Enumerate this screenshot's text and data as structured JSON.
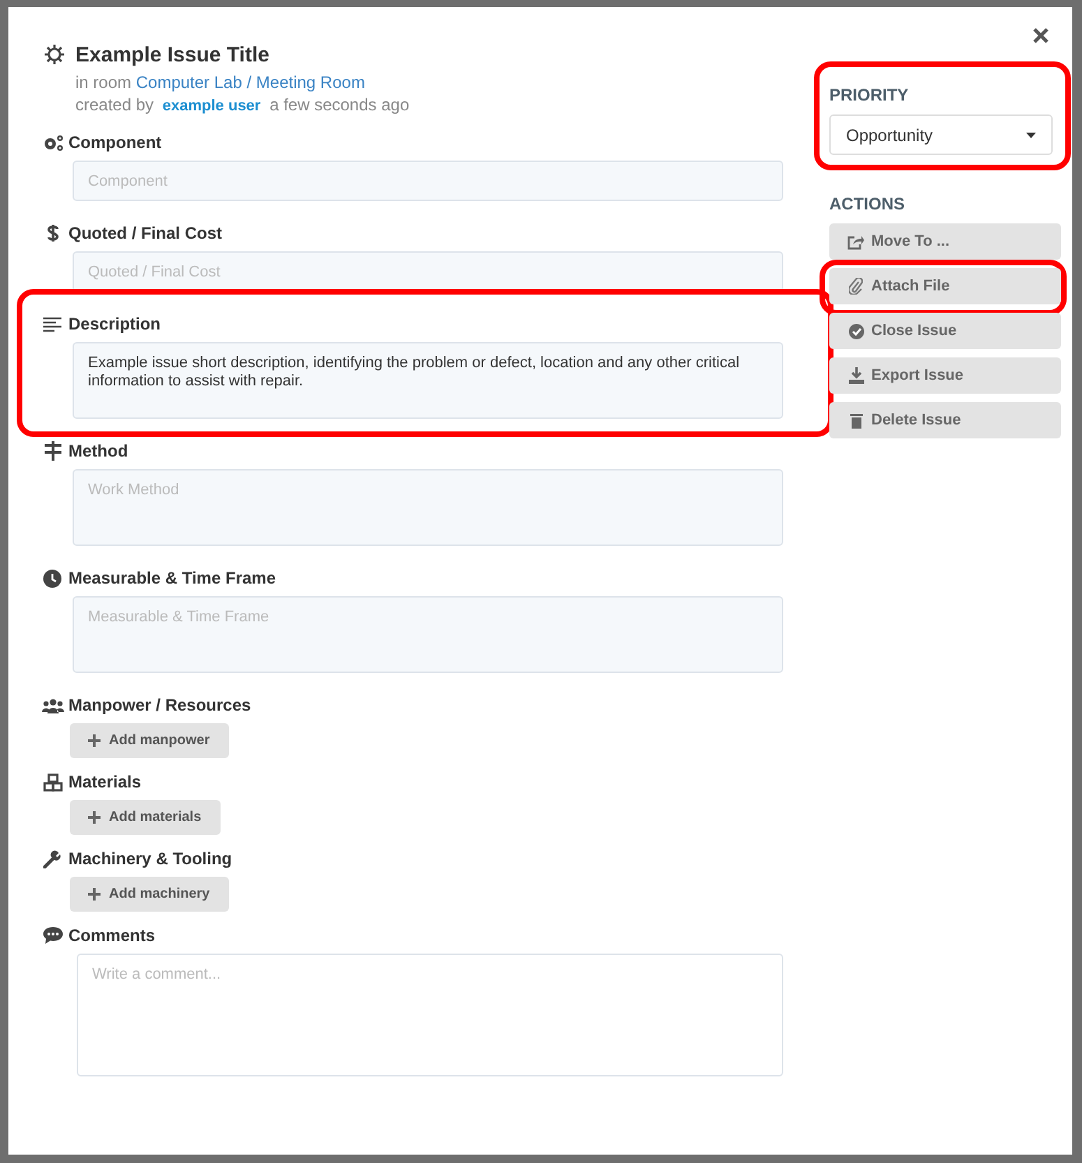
{
  "issue": {
    "title": "Example Issue Title",
    "room_prefix": "in room",
    "room": "Computer Lab / Meeting Room",
    "created_prefix": "created by",
    "user": "example user",
    "time": "a few seconds ago"
  },
  "sections": [
    {
      "label": "Component",
      "kind": "input",
      "placeholder": "Component",
      "highlighted": false
    },
    {
      "label": "Quoted / Final Cost",
      "kind": "input",
      "placeholder": "Quoted / Final Cost",
      "highlighted": false
    },
    {
      "label": "Description",
      "kind": "textarea",
      "value": "Example issue short description, identifying the problem or defect, location and any other critical information to assist with repair.",
      "highlighted": true
    },
    {
      "label": "Method",
      "kind": "textarea",
      "placeholder": "Work Method",
      "highlighted": false
    },
    {
      "label": "Measurable & Time Frame",
      "kind": "textarea",
      "placeholder": "Measurable & Time Frame",
      "highlighted": false
    },
    {
      "label": "Manpower / Resources",
      "kind": "add",
      "button": "Add manpower",
      "highlighted": false
    },
    {
      "label": "Materials",
      "kind": "add",
      "button": "Add materials",
      "highlighted": false
    },
    {
      "label": "Machinery & Tooling",
      "kind": "add",
      "button": "Add machinery",
      "highlighted": false
    },
    {
      "label": "Comments",
      "kind": "comment",
      "placeholder": "Write a comment...",
      "highlighted": false
    }
  ],
  "priority": {
    "heading": "PRIORITY",
    "value": "Opportunity",
    "highlighted": true
  },
  "actions": {
    "heading": "ACTIONS",
    "items": [
      {
        "label": "Move To ...",
        "highlighted": false
      },
      {
        "label": "Attach File",
        "highlighted": true
      },
      {
        "label": "Close Issue",
        "highlighted": false
      },
      {
        "label": "Export Issue",
        "highlighted": false
      },
      {
        "label": "Delete Issue",
        "highlighted": false
      }
    ]
  }
}
